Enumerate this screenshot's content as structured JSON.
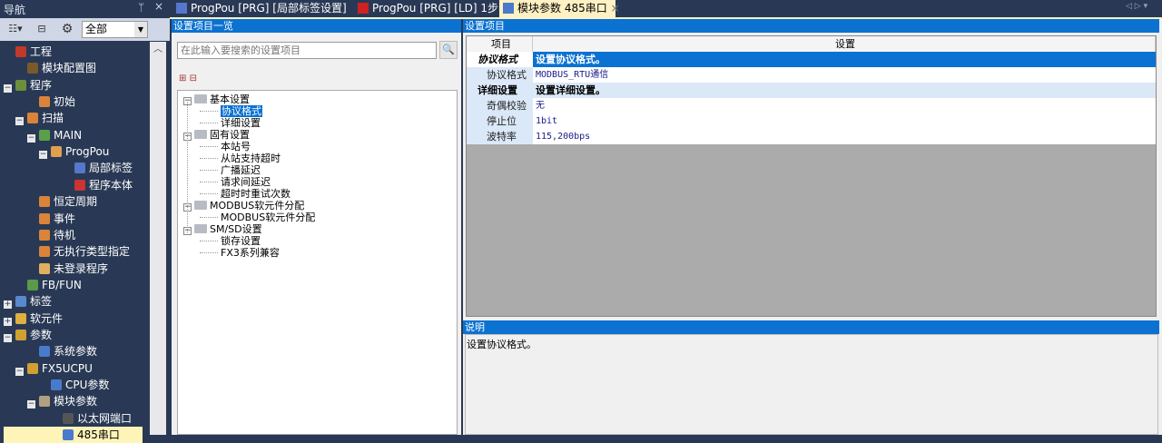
{
  "nav": {
    "title": "导航",
    "pin": "ᛘ",
    "close": "×",
    "filter": "全部",
    "items": [
      {
        "label": "工程",
        "indent": 0,
        "exp": "",
        "color": "#c0392b"
      },
      {
        "label": "模块配置图",
        "indent": 1,
        "exp": "",
        "color": "#7a5a2a"
      },
      {
        "label": "程序",
        "indent": 0,
        "exp": "-",
        "color": "#6b8f3a"
      },
      {
        "label": "初始",
        "indent": 2,
        "exp": "",
        "color": "#d9843a"
      },
      {
        "label": "扫描",
        "indent": 1,
        "exp": "-",
        "color": "#d9843a"
      },
      {
        "label": "MAIN",
        "indent": 2,
        "exp": "-",
        "color": "#5aa04a"
      },
      {
        "label": "ProgPou",
        "indent": 3,
        "exp": "-",
        "color": "#e0a050"
      },
      {
        "label": "局部标签",
        "indent": 5,
        "exp": "",
        "color": "#5577cc"
      },
      {
        "label": "程序本体",
        "indent": 5,
        "exp": "",
        "color": "#cc3333"
      },
      {
        "label": "恒定周期",
        "indent": 2,
        "exp": "",
        "color": "#d9843a"
      },
      {
        "label": "事件",
        "indent": 2,
        "exp": "",
        "color": "#d9843a"
      },
      {
        "label": "待机",
        "indent": 2,
        "exp": "",
        "color": "#d9843a"
      },
      {
        "label": "无执行类型指定",
        "indent": 2,
        "exp": "",
        "color": "#d9843a"
      },
      {
        "label": "未登录程序",
        "indent": 2,
        "exp": "",
        "color": "#e0b060"
      },
      {
        "label": "FB/FUN",
        "indent": 1,
        "exp": "",
        "color": "#5a9a4a"
      },
      {
        "label": "标签",
        "indent": 0,
        "exp": "+",
        "color": "#5a88cc"
      },
      {
        "label": "软元件",
        "indent": 0,
        "exp": "+",
        "color": "#e0b040"
      },
      {
        "label": "参数",
        "indent": 0,
        "exp": "-",
        "color": "#d0a030"
      },
      {
        "label": "系统参数",
        "indent": 2,
        "exp": "",
        "color": "#4a7acc"
      },
      {
        "label": "FX5UCPU",
        "indent": 1,
        "exp": "-",
        "color": "#d0a030"
      },
      {
        "label": "CPU参数",
        "indent": 3,
        "exp": "",
        "color": "#4a7acc"
      },
      {
        "label": "模块参数",
        "indent": 2,
        "exp": "-",
        "color": "#b0a080"
      },
      {
        "label": "以太网端口",
        "indent": 4,
        "exp": "",
        "color": "#555"
      },
      {
        "label": "485串口",
        "indent": 4,
        "exp": "",
        "color": "#4a7acc",
        "selected": true
      }
    ]
  },
  "tabs": [
    {
      "label": "ProgPou [PRG] [局部标签设置]",
      "color": "#5577cc"
    },
    {
      "label": "ProgPou [PRG] [LD] 1步",
      "color": "#cc2222"
    },
    {
      "label": "模块参数 485串口",
      "color": "#4a7acc",
      "active": true
    }
  ],
  "left": {
    "header": "设置项目一览",
    "search_placeholder": "在此输入要搜索的设置项目",
    "tree": [
      {
        "label": "基本设置",
        "level": 0
      },
      {
        "label": "协议格式",
        "level": 1,
        "selected": true
      },
      {
        "label": "详细设置",
        "level": 1
      },
      {
        "label": "固有设置",
        "level": 0
      },
      {
        "label": "本站号",
        "level": 1
      },
      {
        "label": "从站支持超时",
        "level": 1
      },
      {
        "label": "广播延迟",
        "level": 1
      },
      {
        "label": "请求间延迟",
        "level": 1
      },
      {
        "label": "超时时重试次数",
        "level": 1
      },
      {
        "label": "MODBUS软元件分配",
        "level": 0
      },
      {
        "label": "MODBUS软元件分配",
        "level": 1
      },
      {
        "label": "SM/SD设置",
        "level": 0
      },
      {
        "label": "锁存设置",
        "level": 1
      },
      {
        "label": "FX3系列兼容",
        "level": 1
      }
    ]
  },
  "right": {
    "header": "设置项目",
    "col_item": "项目",
    "col_setting": "设置",
    "rows": [
      {
        "type": "sec",
        "item": "协议格式",
        "value": "设置协议格式。",
        "selected": true
      },
      {
        "type": "sub",
        "item": "协议格式",
        "value": "MODBUS_RTU通信"
      },
      {
        "type": "sec",
        "item": "详细设置",
        "value": "设置详细设置。"
      },
      {
        "type": "sub",
        "item": "奇偶校验",
        "value": "无"
      },
      {
        "type": "sub",
        "item": "停止位",
        "value": "1bit"
      },
      {
        "type": "sub",
        "item": "波特率",
        "value": "115,200bps"
      }
    ],
    "desc_header": "说明",
    "desc_text": "设置协议格式。"
  }
}
